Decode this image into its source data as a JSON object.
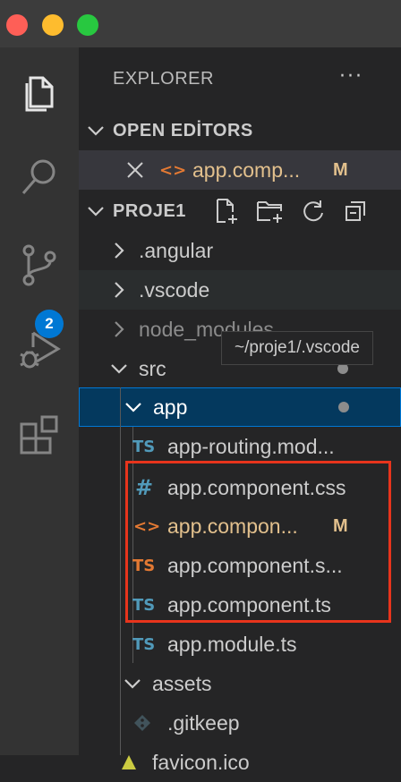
{
  "window": {
    "controls": [
      "close",
      "minimize",
      "maximize"
    ]
  },
  "activity_bar": {
    "items": [
      {
        "name": "explorer",
        "icon": "files-icon"
      },
      {
        "name": "search",
        "icon": "search-icon"
      },
      {
        "name": "source-control",
        "icon": "source-control-icon",
        "badge": "2"
      },
      {
        "name": "run-debug",
        "icon": "run-debug-icon"
      },
      {
        "name": "extensions",
        "icon": "extensions-icon"
      }
    ]
  },
  "sidebar": {
    "title": "EXPLORER",
    "more": "···",
    "open_editors": {
      "title": "OPEN EDİTORS",
      "items": [
        {
          "name": "app.comp...",
          "status": "M"
        }
      ]
    },
    "project": {
      "title": "PROJE1",
      "tree": [
        {
          "label": ".angular"
        },
        {
          "label": ".vscode"
        },
        {
          "label": "node_modules"
        },
        {
          "label": "src"
        },
        {
          "label": "app"
        },
        {
          "label": "app-routing.mod..."
        },
        {
          "label": "app.component.css"
        },
        {
          "label": "app.compon...",
          "status": "M"
        },
        {
          "label": "app.component.s..."
        },
        {
          "label": "app.component.ts"
        },
        {
          "label": "app.module.ts"
        },
        {
          "label": "assets"
        },
        {
          "label": ".gitkeep"
        },
        {
          "label": "favicon.ico"
        }
      ]
    },
    "tooltip": "~/proje1/.vscode"
  },
  "colors": {
    "highlight": "#e8341c",
    "selection": "#04395e",
    "modified": "#e2c08d",
    "badge": "#0078d4"
  }
}
